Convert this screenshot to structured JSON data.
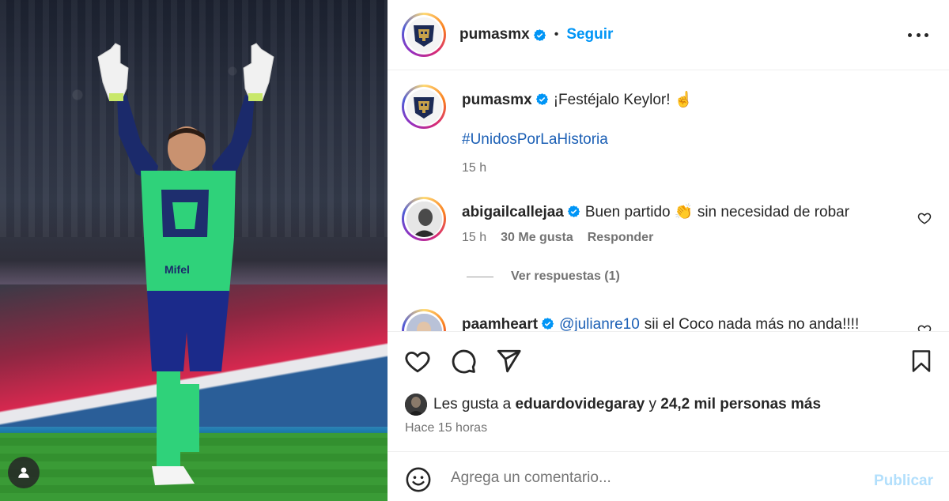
{
  "post": {
    "author": "pumasmx",
    "follow_label": "Seguir",
    "dot": "•"
  },
  "caption": {
    "user": "pumasmx",
    "text": "¡Festéjalo Keylor! ☝️",
    "hashtag": "#UnidosPorLaHistoria",
    "time": "15 h"
  },
  "comments": [
    {
      "user": "abigailcallejaa",
      "text": "Buen partido 👏 sin necesidad de robar",
      "time": "15 h",
      "likes": "30 Me gusta",
      "reply_label": "Responder"
    },
    {
      "user": "paamheart",
      "mention": "@julianre10",
      "text": "sii el Coco nada más no anda!!!!"
    }
  ],
  "replies_label": "Ver respuestas (1)",
  "likes_summary": {
    "prefix": "Les gusta a",
    "user": "eduardovidegaray",
    "joiner": "y",
    "others": "24,2 mil personas más"
  },
  "post_time": "Hace 15 horas",
  "composer": {
    "placeholder": "Agrega un comentario...",
    "post_label": "Publicar"
  },
  "colors": {
    "accent": "#0095f6",
    "post_disabled": "#b2dffc",
    "verified": "#0095f6"
  },
  "icons": [
    "verified-icon",
    "more-options-icon",
    "heart-icon",
    "comment-icon",
    "share-icon",
    "bookmark-icon",
    "emoji-icon",
    "user-icon"
  ]
}
